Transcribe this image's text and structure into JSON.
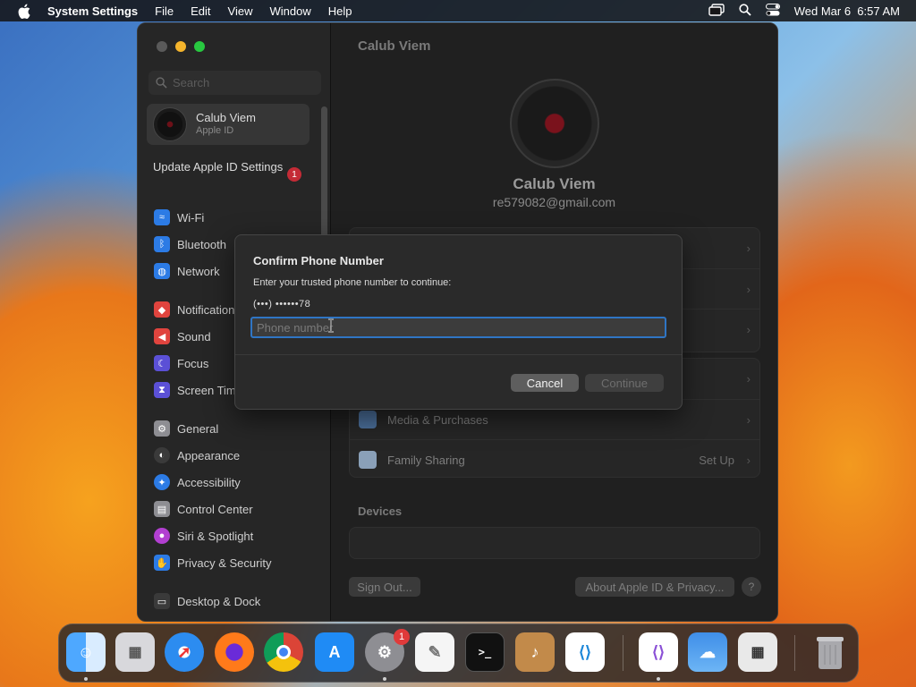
{
  "menubar": {
    "app_name": "System Settings",
    "menus": [
      "File",
      "Edit",
      "View",
      "Window",
      "Help"
    ],
    "clock": "Wed Mar 6  6:57 AM"
  },
  "sidebar": {
    "search_placeholder": "Search",
    "account_name": "Calub Viem",
    "account_sub": "Apple ID",
    "update_label": "Update Apple ID Settings",
    "update_badge": "1",
    "items": [
      {
        "label": "Wi-Fi",
        "icon": "wifi-icon",
        "color": "#2c7be5"
      },
      {
        "label": "Bluetooth",
        "icon": "bluetooth-icon",
        "color": "#2c7be5"
      },
      {
        "label": "Network",
        "icon": "globe-icon",
        "color": "#2c7be5"
      },
      {
        "label": "Notifications",
        "icon": "bell-icon",
        "color": "#e0443e"
      },
      {
        "label": "Sound",
        "icon": "speaker-icon",
        "color": "#e0443e"
      },
      {
        "label": "Focus",
        "icon": "moon-icon",
        "color": "#5b50d6"
      },
      {
        "label": "Screen Time",
        "icon": "hourglass-icon",
        "color": "#5b50d6"
      },
      {
        "label": "General",
        "icon": "gear-icon",
        "color": "#8e8e93"
      },
      {
        "label": "Appearance",
        "icon": "appearance-icon",
        "color": "#3a3a3a"
      },
      {
        "label": "Accessibility",
        "icon": "accessibility-icon",
        "color": "#2c7be5"
      },
      {
        "label": "Control Center",
        "icon": "control-center-icon",
        "color": "#8e8e93"
      },
      {
        "label": "Siri & Spotlight",
        "icon": "siri-icon",
        "color": "#b23fd1"
      },
      {
        "label": "Privacy & Security",
        "icon": "hand-icon",
        "color": "#2c7be5"
      },
      {
        "label": "Desktop & Dock",
        "icon": "dock-icon",
        "color": "#3a3a3a"
      }
    ]
  },
  "main": {
    "title": "Calub Viem",
    "user_name": "Calub Viem",
    "user_email": "re579082@gmail.com",
    "rows": [
      {
        "label": "Media & Purchases",
        "value": ""
      },
      {
        "label": "Family Sharing",
        "value": "Set Up"
      }
    ],
    "devices_label": "Devices",
    "sign_out": "Sign Out...",
    "about": "About Apple ID & Privacy...",
    "help": "?"
  },
  "dialog": {
    "title": "Confirm Phone Number",
    "message": "Enter your trusted phone number to continue:",
    "masked_number": "(•••) ••••••78",
    "phone_placeholder": "Phone number",
    "cancel": "Cancel",
    "continue": "Continue"
  },
  "dock": {
    "settings_badge": "1",
    "apps": [
      "Finder",
      "Launchpad",
      "Safari",
      "Firefox",
      "Chrome",
      "App Store",
      "System Settings",
      "TextEdit",
      "Terminal",
      "GarageBand",
      "Visual Studio Code",
      "Visual Studio",
      "Weather",
      "Calculator",
      "Trash"
    ]
  },
  "colors": {
    "accent": "#2f75c4",
    "badge": "#c42b36"
  }
}
